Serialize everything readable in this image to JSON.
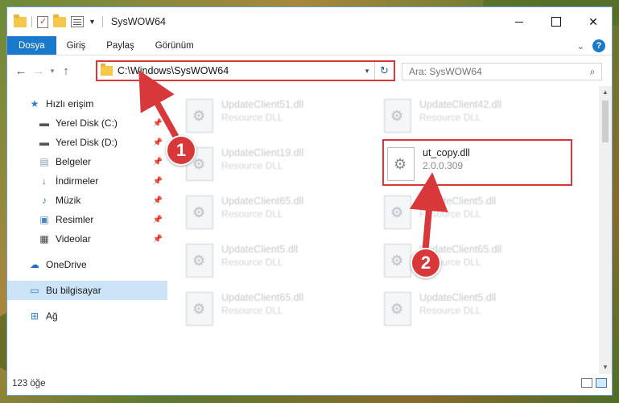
{
  "window": {
    "title": "SysWOW64",
    "controls": {
      "minimize": "",
      "maximize": "",
      "close": "✕"
    }
  },
  "ribbon": {
    "tabs": [
      "Dosya",
      "Giriş",
      "Paylaş",
      "Görünüm"
    ],
    "help": "?"
  },
  "address": {
    "back": "←",
    "forward": "→",
    "up": "↑",
    "path": "C:\\Windows\\SysWOW64",
    "refresh": "↻",
    "search_placeholder": "Ara: SysWOW64"
  },
  "sidebar": {
    "items": [
      {
        "label": "Hızlı erişim",
        "icon": "star-icon",
        "pinned": false
      },
      {
        "label": "Yerel Disk (C:)",
        "icon": "drive-icon",
        "pinned": true
      },
      {
        "label": "Yerel Disk (D:)",
        "icon": "drive-icon",
        "pinned": true
      },
      {
        "label": "Belgeler",
        "icon": "documents-icon",
        "pinned": true
      },
      {
        "label": "İndirmeler",
        "icon": "download-icon",
        "pinned": true
      },
      {
        "label": "Müzik",
        "icon": "music-icon",
        "pinned": true
      },
      {
        "label": "Resimler",
        "icon": "pictures-icon",
        "pinned": true
      },
      {
        "label": "Videolar",
        "icon": "videos-icon",
        "pinned": true
      },
      {
        "label": "OneDrive",
        "icon": "cloud-icon",
        "pinned": false
      },
      {
        "label": "Bu bilgisayar",
        "icon": "computer-icon",
        "pinned": false,
        "selected": true
      },
      {
        "label": "Ağ",
        "icon": "network-icon",
        "pinned": false
      }
    ]
  },
  "files": [
    {
      "name": "UpdateClient51.dll",
      "type": "Resource DLL"
    },
    {
      "name": "UpdateClient42.dll",
      "type": "Resource DLL"
    },
    {
      "name": "UpdateClient19.dll",
      "type": "Resource DLL"
    },
    {
      "name": "ut_copy.dll",
      "type": "2.0.0.309",
      "highlight": true
    },
    {
      "name": "UpdateClient65.dll",
      "type": "Resource DLL"
    },
    {
      "name": "UpdateClient5.dll",
      "type": "Resource DLL"
    },
    {
      "name": "UpdateClient5.dll",
      "type": "Resource DLL"
    },
    {
      "name": "UpdateClient65.dll",
      "type": "Resource DLL"
    },
    {
      "name": "UpdateClient65.dll",
      "type": "Resource DLL"
    },
    {
      "name": "UpdateClient5.dll",
      "type": "Resource DLL"
    }
  ],
  "status": {
    "count": "123 öğe"
  },
  "callouts": [
    "1",
    "2"
  ],
  "colors": {
    "accent": "#1979ca",
    "highlight": "#d9383a",
    "selected": "#cce4f7"
  }
}
